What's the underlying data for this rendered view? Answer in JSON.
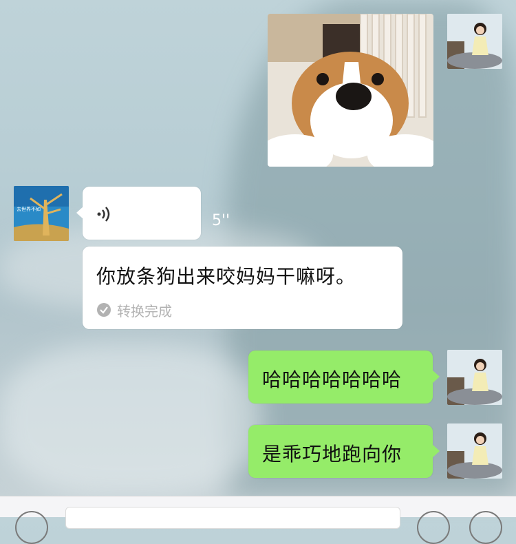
{
  "messages": {
    "voice": {
      "duration": "5''"
    },
    "transcription": {
      "text": "你放条狗出来咬妈妈干嘛呀。",
      "status": "转换完成"
    },
    "reply1": {
      "text": "哈哈哈哈哈哈哈"
    },
    "reply2": {
      "text": "是乖巧地跑向你"
    },
    "sent_image": {
      "subject": "corgi-dog-photo"
    },
    "contact_avatar": {
      "text": "去世界不如去哪 野!"
    }
  },
  "colors": {
    "sent_bubble": "#95ec69",
    "received_bubble": "#ffffff",
    "status_text": "#b2b2b2"
  }
}
